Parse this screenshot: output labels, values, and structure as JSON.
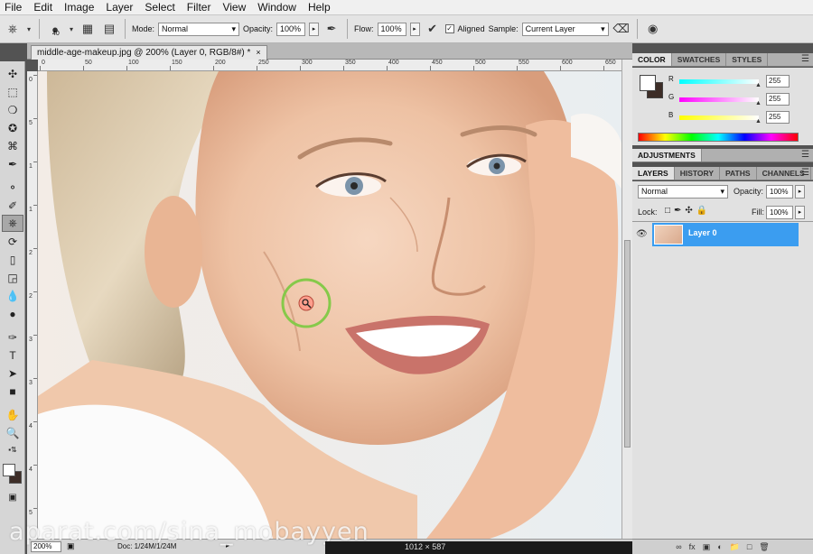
{
  "menubar": {
    "items": [
      "File",
      "Edit",
      "Image",
      "Layer",
      "Select",
      "Filter",
      "View",
      "Window",
      "Help"
    ]
  },
  "options": {
    "brush_size": "40",
    "mode_label": "Mode:",
    "mode_value": "Normal",
    "opacity_label": "Opacity:",
    "opacity_value": "100%",
    "flow_label": "Flow:",
    "flow_value": "100%",
    "aligned_label": "Aligned",
    "sample_label": "Sample:",
    "sample_value": "Current Layer"
  },
  "document": {
    "tab_title": "middle-age-makeup.jpg @ 200% (Layer 0, RGB/8#) *",
    "close_glyph": "×",
    "ruler_h": [
      "0",
      "50",
      "100",
      "150",
      "200",
      "250",
      "300",
      "350",
      "400",
      "450",
      "500",
      "550",
      "600",
      "650"
    ],
    "ruler_v": [
      "0",
      "5",
      "1",
      "1",
      "2",
      "2",
      "3",
      "3",
      "4",
      "4",
      "5"
    ]
  },
  "status": {
    "zoom": "200%",
    "doc_info": "Doc: 1/24M/1/24M",
    "dimensions": "1012 × 587"
  },
  "watermark": "aparat.com/sina_mobayyen",
  "color_panel": {
    "tabs": [
      "COLOR",
      "SWATCHES",
      "STYLES"
    ],
    "r_label": "R",
    "g_label": "G",
    "b_label": "B",
    "r_value": "255",
    "g_value": "255",
    "b_value": "255",
    "fg_color": "#ffffff",
    "bg_color": "#3d2d27"
  },
  "adjustments_panel": {
    "tab": "ADJUSTMENTS"
  },
  "layers_panel": {
    "tabs": [
      "LAYERS",
      "HISTORY",
      "PATHS",
      "CHANNELS"
    ],
    "blend_mode": "Normal",
    "opacity_label": "Opacity:",
    "opacity_value": "100%",
    "lock_label": "Lock:",
    "fill_label": "Fill:",
    "fill_value": "100%",
    "layer_name": "Layer 0",
    "accent": "#3b9df0"
  },
  "tools": [
    "move-tool",
    "marquee-tool",
    "lasso-tool",
    "quick-selection-tool",
    "crop-tool",
    "eyedropper-tool",
    "spot-healing-tool",
    "brush-tool",
    "clone-stamp-tool",
    "history-brush-tool",
    "eraser-tool",
    "gradient-tool",
    "blur-tool",
    "dodge-tool",
    "pen-tool",
    "type-tool",
    "path-selection-tool",
    "shape-tool",
    "hand-tool",
    "zoom-tool"
  ]
}
